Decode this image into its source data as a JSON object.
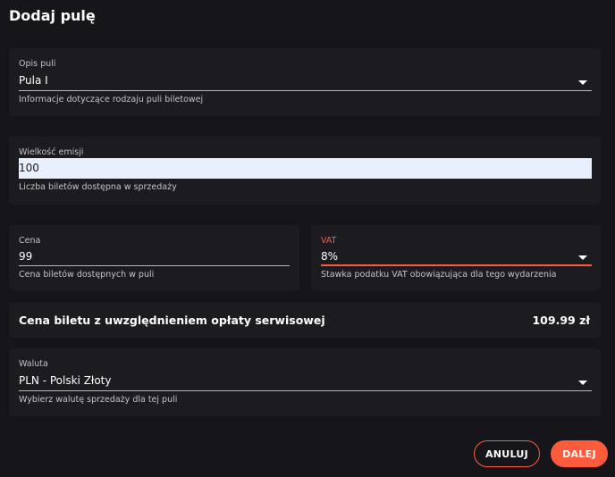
{
  "title": "Dodaj pulę",
  "pool_description": {
    "label": "Opis puli",
    "value": "Pula I",
    "helper": "Informacje dotyczące rodzaju puli biletowej"
  },
  "emission": {
    "label": "Wielkość emisji",
    "value": "100",
    "helper": "Liczba biletów dostępna w sprzedaży"
  },
  "price": {
    "label": "Cena",
    "value": "99",
    "helper": "Cena biletów dostępnych w puli"
  },
  "vat": {
    "label": "VAT",
    "value": "8%",
    "helper": "Stawka podatku VAT obowiązująca dla tego wydarzenia"
  },
  "summary": {
    "label": "Cena biletu z uwzględnieniem opłaty serwisowej",
    "value": "109.99 zł"
  },
  "currency": {
    "label": "Waluta",
    "value": "PLN - Polski Złoty",
    "helper": "Wybierz walutę sprzedaży dla tej puli"
  },
  "buttons": {
    "cancel": "ANULUJ",
    "next": "DALEJ"
  },
  "colors": {
    "accent": "#ff5a3c",
    "background": "#16161a",
    "card": "#1c1c20"
  }
}
